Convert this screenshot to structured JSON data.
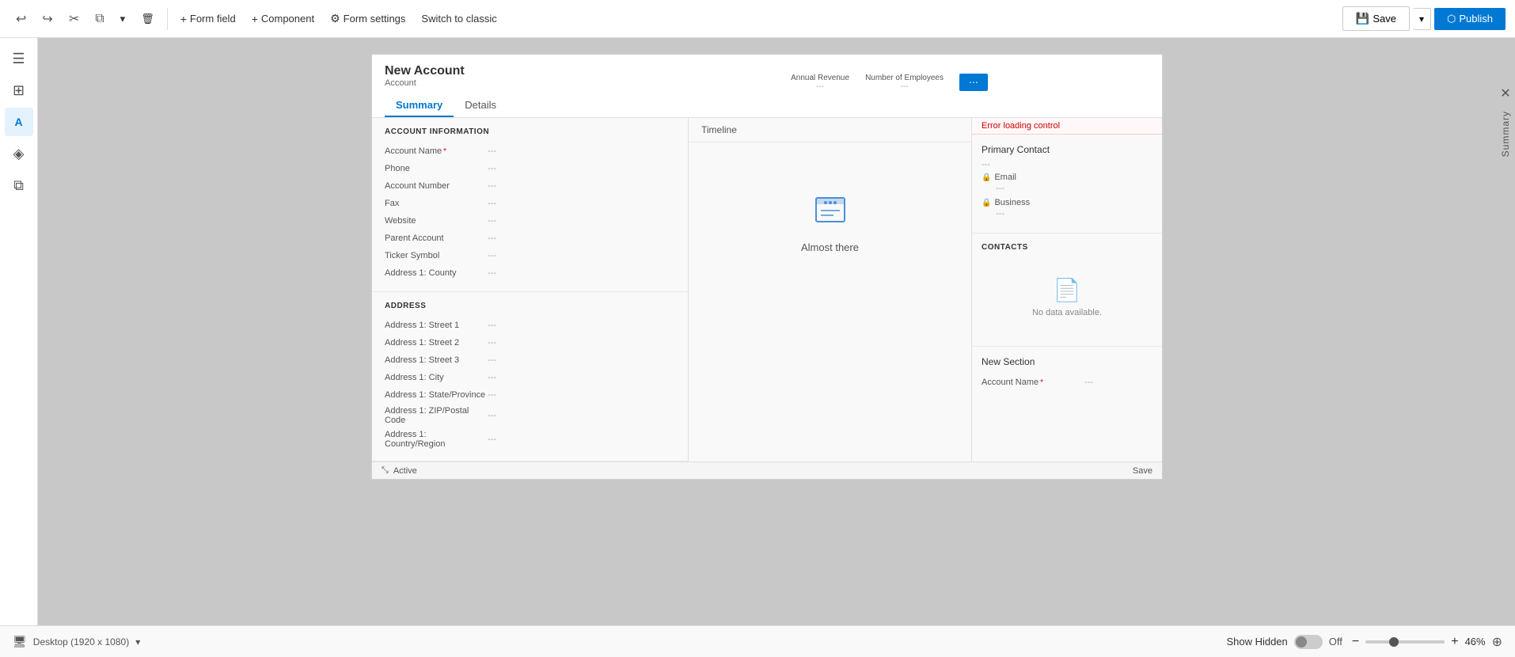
{
  "toolbar": {
    "undo_icon": "↩",
    "redo_icon": "↪",
    "cut_icon": "✂",
    "copy_icon": "⧉",
    "dropdown_icon": "▾",
    "delete_icon": "🗑",
    "form_field_label": "Form field",
    "component_label": "Component",
    "form_settings_label": "Form settings",
    "switch_label": "Switch to classic",
    "save_label": "Save",
    "publish_label": "Publish"
  },
  "sidebar": {
    "items": [
      {
        "icon": "☰",
        "name": "menu-icon"
      },
      {
        "icon": "⊞",
        "name": "grid-icon"
      },
      {
        "icon": "A",
        "name": "text-icon"
      },
      {
        "icon": "⊕",
        "name": "layers-icon"
      },
      {
        "icon": "⧉",
        "name": "copy2-icon"
      }
    ]
  },
  "form": {
    "title": "New Account",
    "subtitle": "Account",
    "tabs": [
      "Summary",
      "Details"
    ],
    "active_tab": "Summary",
    "header_fields": [
      {
        "label": "Annual Revenue",
        "value": "---"
      },
      {
        "label": "Number of Employees",
        "value": "---"
      }
    ],
    "account_info_section": {
      "title": "ACCOUNT INFORMATION",
      "fields": [
        {
          "label": "Account Name",
          "required": true,
          "value": "---"
        },
        {
          "label": "Phone",
          "required": false,
          "value": "---"
        },
        {
          "label": "Account Number",
          "required": false,
          "value": "---"
        },
        {
          "label": "Fax",
          "required": false,
          "value": "---"
        },
        {
          "label": "Website",
          "required": false,
          "value": "---"
        },
        {
          "label": "Parent Account",
          "required": false,
          "value": "---"
        },
        {
          "label": "Ticker Symbol",
          "required": false,
          "value": "---"
        },
        {
          "label": "Address 1: County",
          "required": false,
          "value": "---"
        }
      ]
    },
    "address_section": {
      "title": "ADDRESS",
      "fields": [
        {
          "label": "Address 1: Street 1",
          "value": "---"
        },
        {
          "label": "Address 1: Street 2",
          "value": "---"
        },
        {
          "label": "Address 1: Street 3",
          "value": "---"
        },
        {
          "label": "Address 1: City",
          "value": "---"
        },
        {
          "label": "Address 1: State/Province",
          "value": "---"
        },
        {
          "label": "Address 1: ZIP/Postal Code",
          "value": "---"
        },
        {
          "label": "Address 1: Country/Region",
          "value": "---"
        }
      ]
    },
    "timeline": {
      "icon": "📁",
      "label": "Timeline",
      "message": "Almost there"
    },
    "error_banner": "Error loading control",
    "contact": {
      "title": "Primary Contact",
      "value": "---",
      "email_label": "Email",
      "email_value": "---",
      "business_label": "Business",
      "business_value": "---"
    },
    "contacts_section": {
      "title": "CONTACTS",
      "no_data": "No data available."
    },
    "new_section": {
      "title": "New Section",
      "fields": [
        {
          "label": "Account Name",
          "required": true,
          "value": "---"
        }
      ]
    }
  },
  "bottom": {
    "device_label": "Desktop (1920 x 1080)",
    "status_label": "Active",
    "save_label": "Save",
    "show_hidden_label": "Show Hidden",
    "toggle_state": "Off",
    "zoom_minus": "−",
    "zoom_plus": "+",
    "zoom_value": "46%"
  },
  "right_panel": {
    "label": "Summary",
    "close_icon": "✕"
  }
}
